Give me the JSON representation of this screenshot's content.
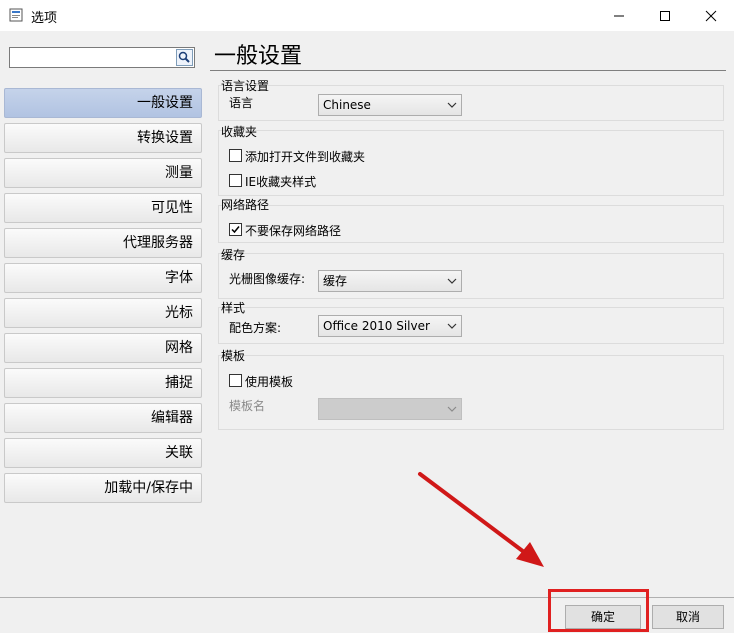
{
  "window": {
    "title": "选项"
  },
  "search": {
    "value": "",
    "placeholder": ""
  },
  "sidebar": {
    "items": [
      {
        "label": "一般设置",
        "active": true
      },
      {
        "label": "转换设置"
      },
      {
        "label": "测量"
      },
      {
        "label": "可见性"
      },
      {
        "label": "代理服务器"
      },
      {
        "label": "字体"
      },
      {
        "label": "光标"
      },
      {
        "label": "网格"
      },
      {
        "label": "捕捉"
      },
      {
        "label": "编辑器"
      },
      {
        "label": "关联"
      },
      {
        "label": "加载中/保存中"
      }
    ]
  },
  "main": {
    "title": "一般设置",
    "language": {
      "group": "语言设置",
      "label": "语言",
      "value": "Chinese"
    },
    "favorites": {
      "group": "收藏夹",
      "add_to_favorites": {
        "label": "添加打开文件到收藏夹",
        "checked": false
      },
      "ie_style": {
        "label": "IE收藏夹样式",
        "checked": false
      }
    },
    "network": {
      "group": "网络路径",
      "dont_save": {
        "label": "不要保存网络路径",
        "checked": true
      }
    },
    "cache": {
      "group": "缓存",
      "label": "光栅图像缓存:",
      "value": "缓存"
    },
    "style": {
      "group": "样式",
      "label": "配色方案:",
      "value": "Office 2010 Silver"
    },
    "template": {
      "group": "模板",
      "use_template": {
        "label": "使用模板",
        "checked": false
      },
      "name_label": "模板名",
      "name_value": ""
    }
  },
  "buttons": {
    "ok": "确定",
    "cancel": "取消"
  },
  "colors": {
    "accent_red": "#e02020",
    "active_nav": "#b8c8e6"
  }
}
